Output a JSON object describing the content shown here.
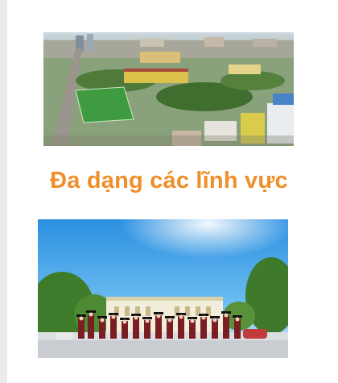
{
  "page": {
    "heading": "Đa dạng các lĩnh vực",
    "heading_color": "#ef8f2b"
  },
  "images": {
    "top": {
      "name": "aerial-campus-photo"
    },
    "bottom": {
      "name": "graduation-group-photo"
    }
  }
}
